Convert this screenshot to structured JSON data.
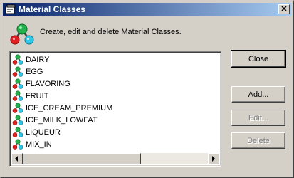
{
  "window": {
    "title": "Material Classes",
    "close_glyph": "✕"
  },
  "header": {
    "description": "Create, edit and delete Material Classes."
  },
  "list": {
    "items": [
      "DAIRY",
      "EGG",
      "FLAVORING",
      "FRUIT",
      "ICE_CREAM_PREMIUM",
      "ICE_MILK_LOWFAT",
      "LIQUEUR",
      "MIX_IN"
    ]
  },
  "buttons": {
    "close": "Close",
    "add": "Add...",
    "edit": "Edit...",
    "delete": "Delete"
  },
  "icons": {
    "title": "window-app-icon",
    "header": "molecule-icon",
    "item": "material-class-icon"
  },
  "colors": {
    "titlebar_start": "#0a246a",
    "titlebar_end": "#a6caf0",
    "molecule_green": "#22b14c",
    "molecule_red": "#e02020",
    "molecule_cyan": "#2fc8e8"
  }
}
